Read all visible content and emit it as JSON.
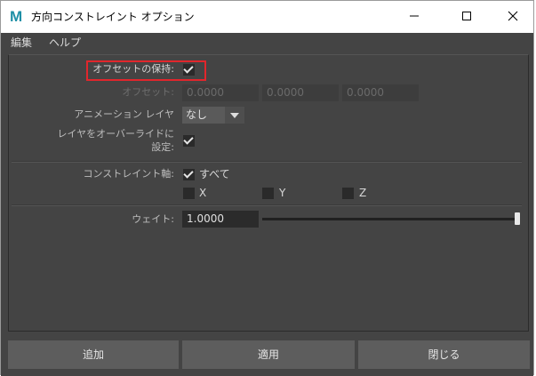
{
  "window": {
    "title": "方向コンストレイント オプション",
    "app_icon": "M",
    "controls": {
      "minimize": "—",
      "maximize": "☐",
      "close": "✕"
    }
  },
  "menu": {
    "edit": "編集",
    "help": "ヘルプ"
  },
  "options": {
    "maintain_offset": {
      "label": "オフセットの保持:",
      "checked": true
    },
    "offset": {
      "label": "オフセット:",
      "x": "0.0000",
      "y": "0.0000",
      "z": "0.0000"
    },
    "animation_layer": {
      "label": "アニメーション レイヤ",
      "value": "なし"
    },
    "override_layer": {
      "label_line1": "レイヤをオーバーライドに",
      "label_line2": "設定:",
      "checked": true
    },
    "constraint_axes": {
      "label": "コンストレイント軸:",
      "all": {
        "label": "すべて",
        "checked": true
      },
      "x": {
        "label": "X",
        "checked": false
      },
      "y": {
        "label": "Y",
        "checked": false
      },
      "z": {
        "label": "Z",
        "checked": false
      }
    },
    "weight": {
      "label": "ウェイト:",
      "value": "1.0000",
      "slider_fraction": 1.0
    }
  },
  "buttons": {
    "add": "追加",
    "apply": "適用",
    "close": "閉じる"
  },
  "colors": {
    "highlight": "#e1262c",
    "background": "#444444"
  }
}
